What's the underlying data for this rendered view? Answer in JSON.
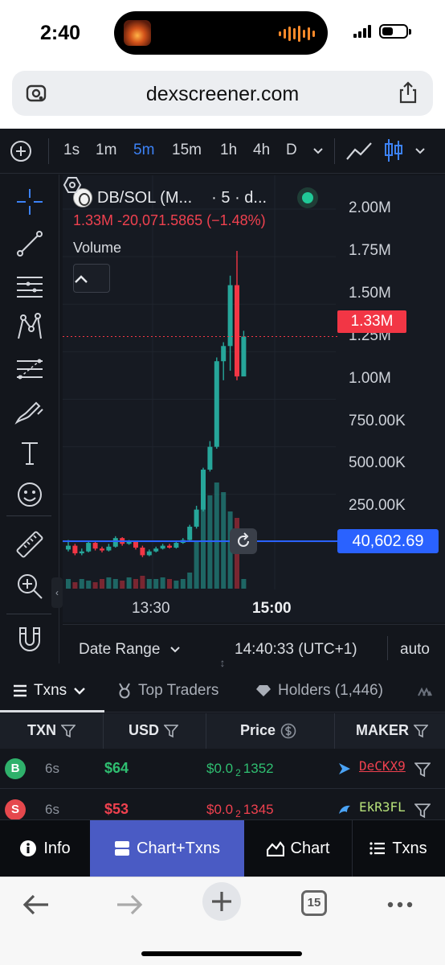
{
  "status": {
    "time": "2:40"
  },
  "browser": {
    "url": "dexscreener.com",
    "tab_count": "15"
  },
  "toolbar": {
    "timeframes": [
      "1s",
      "1m",
      "5m",
      "15m",
      "1h",
      "4h",
      "D"
    ],
    "active_timeframe": "5m"
  },
  "chart": {
    "pair": "DB/SOL (M...",
    "interval": "· 5 · d...",
    "ohlc_line": "1.33M  -20,071.5865 (−1.48%)",
    "volume_label": "Volume",
    "price_axis": [
      "2.00M",
      "1.75M",
      "1.50M",
      "1.25M",
      "1.00M",
      "750.00K",
      "500.00K",
      "250.00K"
    ],
    "current_price_tag": "1.33M",
    "crosshair_value_tag": "40,602.69",
    "time_axis": [
      "13:30",
      "15:00"
    ],
    "date_range_label": "Date Range",
    "clock": "14:40:33 (UTC+1)",
    "scale_mode": "auto"
  },
  "chart_data": {
    "type": "candlestick",
    "title": "DB/SOL",
    "ylim": [
      0,
      2100000
    ],
    "x_ticks": [
      "13:30",
      "15:00"
    ],
    "series": [
      {
        "name": "price",
        "candles": [
          [
            210000,
            230000,
            260000,
            200000
          ],
          [
            230000,
            190000,
            240000,
            180000
          ],
          [
            190000,
            200000,
            215000,
            180000
          ],
          [
            200000,
            245000,
            255000,
            195000
          ],
          [
            245000,
            215000,
            250000,
            205000
          ],
          [
            215000,
            205000,
            225000,
            195000
          ],
          [
            205000,
            225000,
            240000,
            200000
          ],
          [
            225000,
            270000,
            280000,
            220000
          ],
          [
            270000,
            240000,
            275000,
            230000
          ],
          [
            240000,
            250000,
            260000,
            235000
          ],
          [
            250000,
            220000,
            255000,
            210000
          ],
          [
            220000,
            180000,
            230000,
            170000
          ],
          [
            180000,
            200000,
            210000,
            175000
          ],
          [
            200000,
            215000,
            225000,
            195000
          ],
          [
            215000,
            230000,
            240000,
            210000
          ],
          [
            230000,
            220000,
            240000,
            215000
          ],
          [
            220000,
            245000,
            255000,
            215000
          ],
          [
            245000,
            260000,
            270000,
            240000
          ],
          [
            260000,
            330000,
            340000,
            255000
          ],
          [
            330000,
            420000,
            440000,
            320000
          ],
          [
            420000,
            630000,
            640000,
            410000
          ],
          [
            630000,
            750000,
            780000,
            620000
          ],
          [
            750000,
            1200000,
            1220000,
            740000
          ],
          [
            1200000,
            1280000,
            1300000,
            1100000
          ],
          [
            1280000,
            1600000,
            1650000,
            1150000
          ],
          [
            1600000,
            1120000,
            1780000,
            1100000
          ],
          [
            1120000,
            1330000,
            1360000,
            1300000
          ]
        ]
      },
      {
        "name": "volume",
        "values": [
          0.3,
          0.2,
          0.3,
          0.25,
          0.2,
          0.3,
          0.35,
          0.3,
          0.25,
          0.35,
          0.3,
          0.4,
          0.3,
          0.3,
          0.35,
          0.3,
          0.25,
          0.3,
          0.5,
          1.5,
          2.7,
          2.9,
          3.3,
          3.0,
          2.4,
          2.2,
          0.3
        ]
      }
    ]
  },
  "tabs": [
    {
      "label": "Txns"
    },
    {
      "label": "Top Traders"
    },
    {
      "label": "Holders (1,446)"
    }
  ],
  "table": {
    "headers": [
      "TXN",
      "USD",
      "Price",
      "MAKER"
    ],
    "rows": [
      {
        "type": "B",
        "age": "6s",
        "usd": "$64",
        "price_prefix": "$0.0",
        "price_sub": "2",
        "price_rest": "1352",
        "maker": "DeCKX9"
      },
      {
        "type": "S",
        "age": "6s",
        "usd": "$53",
        "price_prefix": "$0.0",
        "price_sub": "2",
        "price_rest": "1345",
        "maker": "EkR3FL"
      }
    ]
  },
  "bottom_nav": [
    "Info",
    "Chart+Txns",
    "Chart",
    "Txns"
  ],
  "colors": {
    "accent": "#3c82f6",
    "up": "#26a69a",
    "down": "#f23645",
    "nav_active": "#4a5bc4"
  }
}
